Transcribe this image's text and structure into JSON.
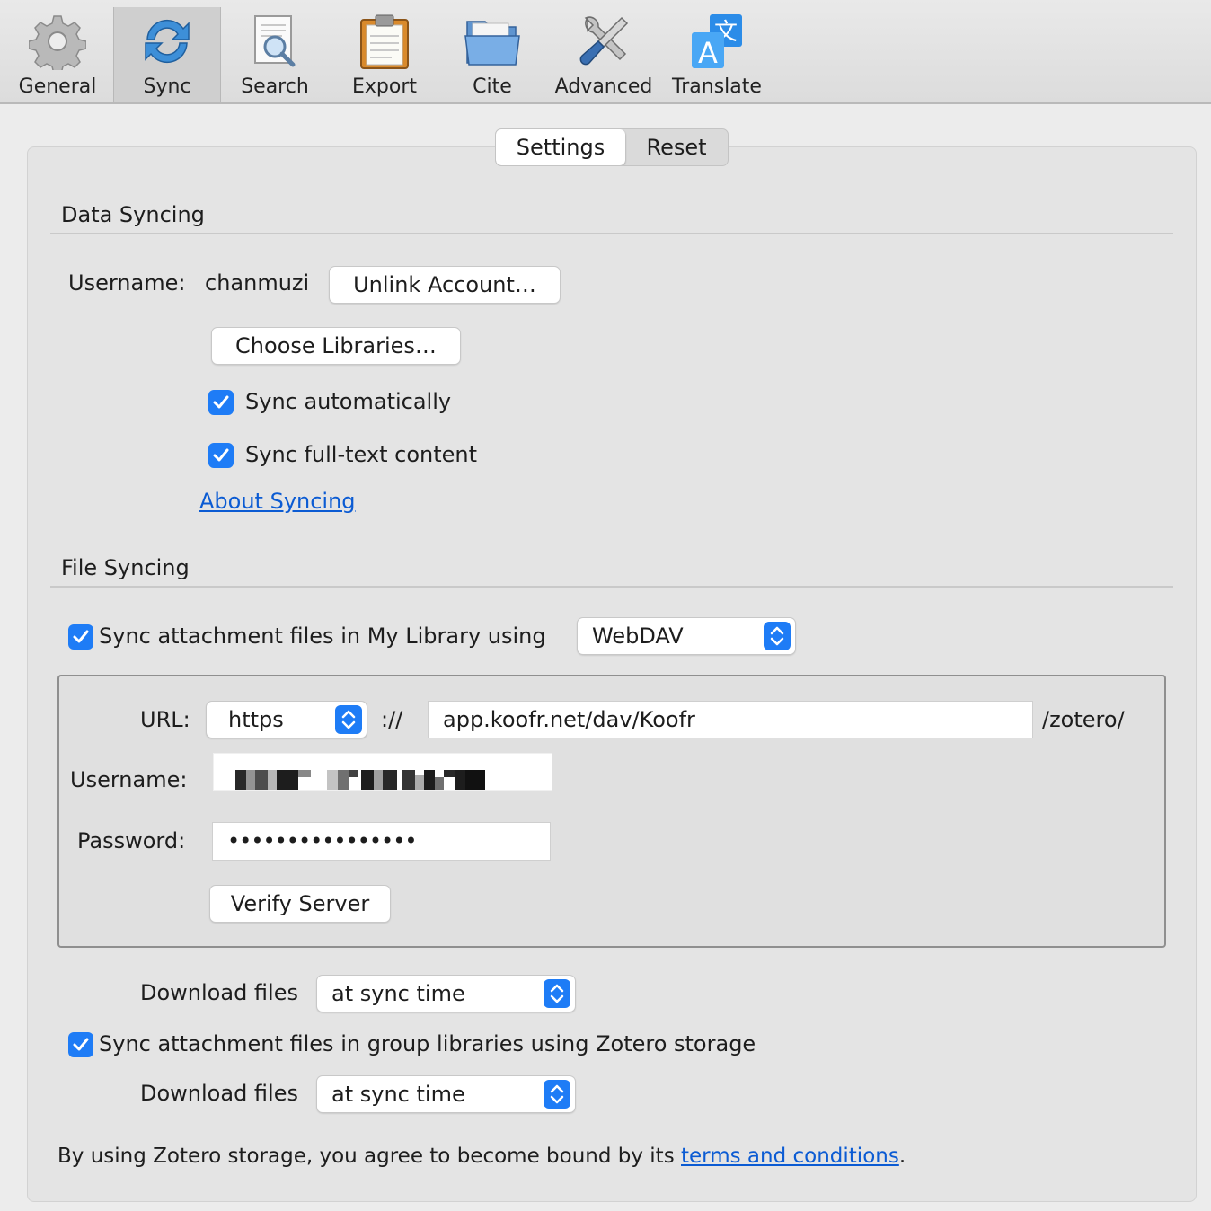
{
  "toolbar": {
    "tabs": [
      {
        "label": "General",
        "icon": "gear-icon"
      },
      {
        "label": "Sync",
        "icon": "sync-icon"
      },
      {
        "label": "Search",
        "icon": "search-icon"
      },
      {
        "label": "Export",
        "icon": "clipboard-icon"
      },
      {
        "label": "Cite",
        "icon": "folder-icon"
      },
      {
        "label": "Advanced",
        "icon": "tools-icon"
      },
      {
        "label": "Translate",
        "icon": "translate-icon"
      }
    ],
    "active": "Sync"
  },
  "segmented": {
    "settings": "Settings",
    "reset": "Reset"
  },
  "data_syncing": {
    "heading": "Data Syncing",
    "username_label": "Username:",
    "username_value": "chanmuzi",
    "unlink_button": "Unlink Account…",
    "choose_libraries_button": "Choose Libraries…",
    "sync_auto": {
      "label": "Sync automatically",
      "checked": true
    },
    "sync_fulltext": {
      "label": "Sync full-text content",
      "checked": true
    },
    "about_link": "About Syncing"
  },
  "file_syncing": {
    "heading": "File Syncing",
    "my_library": {
      "label": "Sync attachment files in My Library using",
      "checked": true,
      "method": "WebDAV"
    },
    "webdav": {
      "url_label": "URL:",
      "scheme": "https",
      "separator": "://",
      "url_value": "app.koofr.net/dav/Koofr",
      "url_suffix": "/zotero/",
      "username_label": "Username:",
      "password_label": "Password:",
      "password_value": "••••••••••••••••",
      "verify_button": "Verify Server"
    },
    "download_label": "Download files",
    "download_value": "at sync time",
    "group": {
      "label": "Sync attachment files in group libraries using Zotero storage",
      "checked": true
    },
    "group_download_label": "Download files",
    "group_download_value": "at sync time",
    "terms_prefix": "By using Zotero storage, you agree to become bound by its ",
    "terms_link": "terms and conditions",
    "terms_suffix": "."
  },
  "colors": {
    "accent": "#1e7cf6",
    "link": "#0b5bd3"
  }
}
